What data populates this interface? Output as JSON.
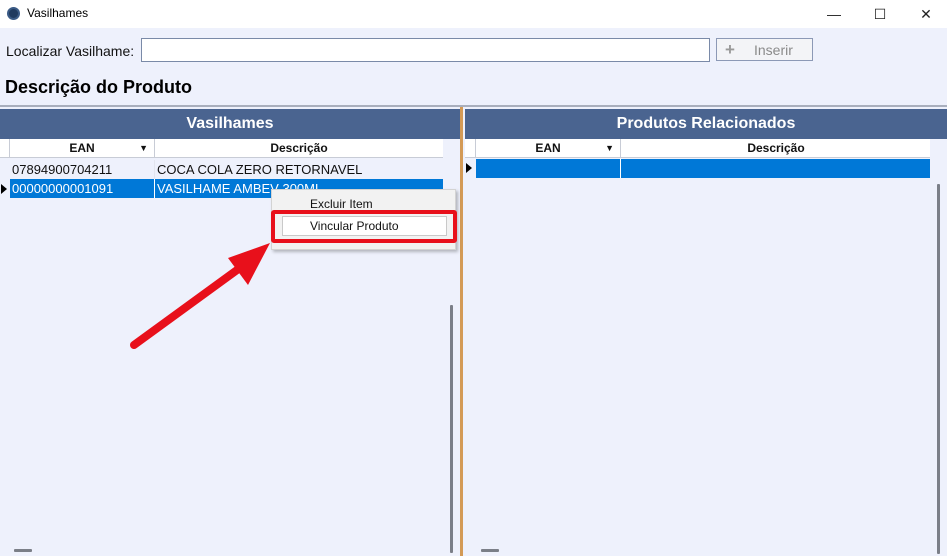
{
  "window": {
    "title": "Vasilhames",
    "minimize": "—",
    "maximize": "☐",
    "close": "✕"
  },
  "search": {
    "label": "Localizar Vasilhame:",
    "value": "",
    "placeholder": "",
    "insert_button": "Inserir",
    "insert_icon": "plus-icon"
  },
  "product_title": "Descrição do Produto",
  "left_panel": {
    "header": "Vasilhames",
    "columns": [
      "EAN",
      "Descrição"
    ],
    "rows": [
      {
        "ean": "07894900704211",
        "descricao": "COCA COLA ZERO RETORNAVEL"
      },
      {
        "ean": "00000000001091",
        "descricao": "VASILHAME AMBEV 300ML"
      }
    ],
    "selected_row": 1
  },
  "right_panel": {
    "header": "Produtos Relacionados",
    "columns": [
      "EAN",
      "Descrição"
    ],
    "rows": [
      {
        "ean": "",
        "descricao": ""
      }
    ],
    "selected_row": 0
  },
  "context_menu": {
    "items": [
      "Excluir Item",
      "Vincular Produto"
    ],
    "highlighted_item": "Vincular Produto"
  },
  "colors": {
    "panel_header": "#4a6490",
    "selection": "#0078d7",
    "annotation": "#e8101b",
    "splitter": "#d39a56"
  }
}
